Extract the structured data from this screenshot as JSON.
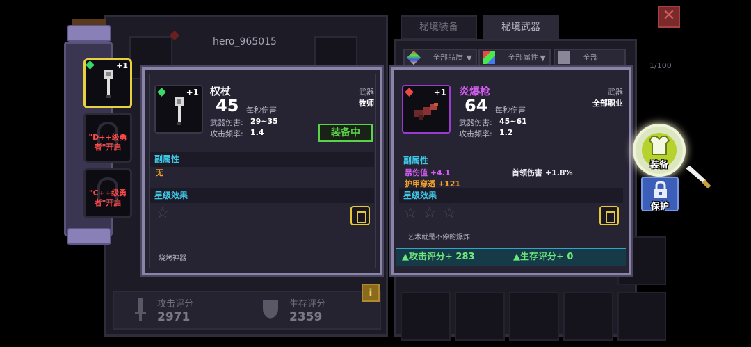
{
  "hero": {
    "name": "hero_965015",
    "attack_score_label": "攻击评分",
    "attack_score_value": "2971",
    "survival_score_label": "生存评分",
    "survival_score_value": "2359",
    "info_icon": "i"
  },
  "slots": {
    "active_level": "+1",
    "locked_1": "\"D++级勇者\"开启",
    "locked_2": "\"C++级勇者\"开启"
  },
  "tabs": [
    {
      "label": "秘境装备",
      "active": false
    },
    {
      "label": "秘境武器",
      "active": true
    }
  ],
  "filters": [
    {
      "label": "全部品质"
    },
    {
      "label": "全部属性"
    },
    {
      "label": "全部"
    }
  ],
  "inventory_count": "1/100",
  "equipped_card": {
    "level": "+1",
    "name": "权杖",
    "type_label": "武器",
    "class_label": "牧师",
    "dps_value": "45",
    "dps_label": "每秒伤害",
    "damage_label": "武器伤害:",
    "damage_value": "29~35",
    "rate_label": "攻击频率:",
    "rate_value": "1.4",
    "equipped_badge": "装备中",
    "sub_attr_title": "副属性",
    "sub_attr_none": "无",
    "star_title": "星级效果",
    "flavor": "烧烤神器"
  },
  "new_card": {
    "level": "+1",
    "name": "炎爆枪",
    "type_label": "武器",
    "class_label": "全部职业",
    "dps_value": "64",
    "dps_label": "每秒伤害",
    "damage_label": "武器伤害:",
    "damage_value": "45~61",
    "rate_label": "攻击频率:",
    "rate_value": "1.2",
    "sub_attr_title": "副属性",
    "attr_1": "暴伤值 +4.1",
    "attr_2": "首领伤害 +1.8%",
    "attr_3": "护甲穿透 +121",
    "star_title": "星级效果",
    "flavor": "艺术就是不停的爆炸",
    "attack_delta": "▲攻击评分+ 283",
    "survival_delta": "▲生存评分+ 0"
  },
  "actions": {
    "equip": "装备",
    "protect": "保护",
    "close": "✕"
  },
  "colors": {
    "rarity_purple": "#d45cf2",
    "stat_cyan": "#3ec8e8",
    "equipped_green": "#5ad24a",
    "stat_orange": "#f2a028"
  }
}
